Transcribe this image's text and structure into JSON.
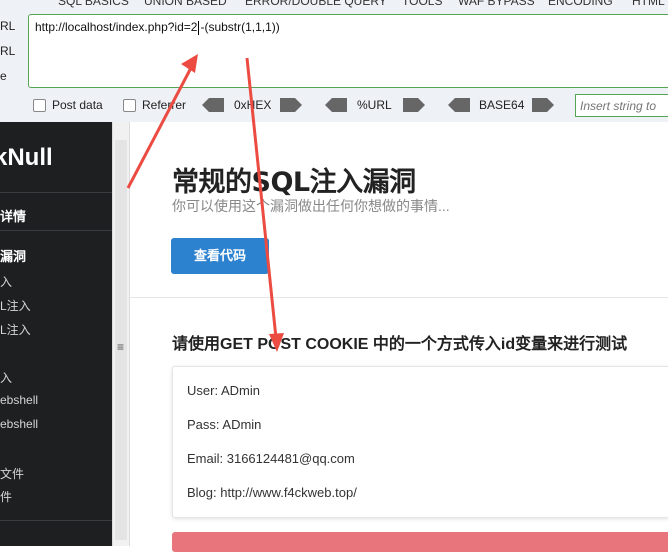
{
  "toolbar": {
    "menu": [
      "SQL BASICS",
      "UNION BASED",
      "ERROR/DOUBLE QUERY",
      "TOOLS",
      "WAF BYPASS",
      "ENCODING",
      "HTML"
    ],
    "side_labels": [
      "RL",
      "RL",
      "e"
    ],
    "url_before_cursor": "http://localhost/index.php?id=2",
    "url_after_cursor": "-(substr(1,1,1))",
    "post_data_label": "Post data",
    "referrer_label": "Referrer",
    "hex_label": "0xHEX",
    "url_label": "%URL",
    "base64_label": "BASE64",
    "insert_placeholder": "Insert string to"
  },
  "sidebar": {
    "brand": "kNull",
    "items": [
      "详情",
      "漏洞",
      "入",
      "L注入",
      "L注入",
      "入",
      "ebshell",
      "ebshell",
      "文件",
      "件"
    ]
  },
  "main": {
    "title": "常规的SQL注入漏洞",
    "subtitle": "你可以使用这个漏洞做出任何你想做的事情...",
    "code_button": "查看代码",
    "section_heading": "请使用GET POST COOKIE 中的一个方式传入id变量来进行测试",
    "info": {
      "user": "User: ADmin",
      "pass": "Pass: ADmin",
      "email": "Email: 3166124481@qq.com",
      "blog": "Blog: http://www.f4ckweb.top/"
    }
  },
  "colors": {
    "accent_green": "#56a554",
    "button_blue": "#2d82cf",
    "arrow_red": "#ec4b42",
    "alert_red": "#e8757b",
    "sidebar_bg": "#1d1f21"
  }
}
